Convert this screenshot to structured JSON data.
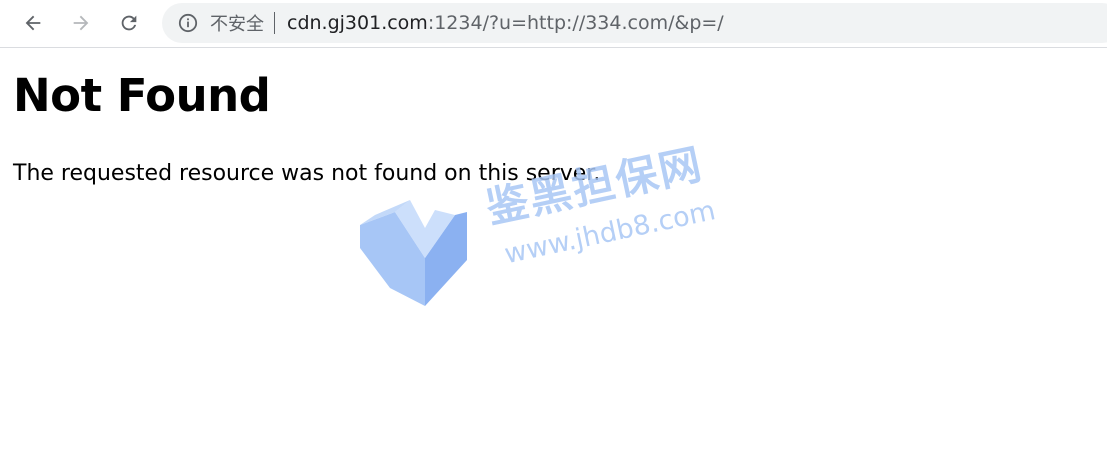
{
  "browser": {
    "nav": {
      "back_icon": "arrow-left-icon",
      "forward_icon": "arrow-right-icon",
      "reload_icon": "reload-icon"
    },
    "address_bar": {
      "info_icon": "info-circle-icon",
      "security_label": "不安全",
      "host": "cdn.gj301.com",
      "path": ":1234/?u=http://334.com/&p=/"
    }
  },
  "page": {
    "heading": "Not Found",
    "message": "The requested resource was not found on this server."
  },
  "watermark": {
    "logo_icon": "jhdb8-logo-icon",
    "text_cn": "鉴黑担保网",
    "text_url": "www.jhdb8.com"
  },
  "colors": {
    "toolbar_bg": "#ffffff",
    "omnibox_bg": "#f1f3f4",
    "icon_gray": "#5f6368",
    "watermark_blue": "#a9c7f5"
  }
}
